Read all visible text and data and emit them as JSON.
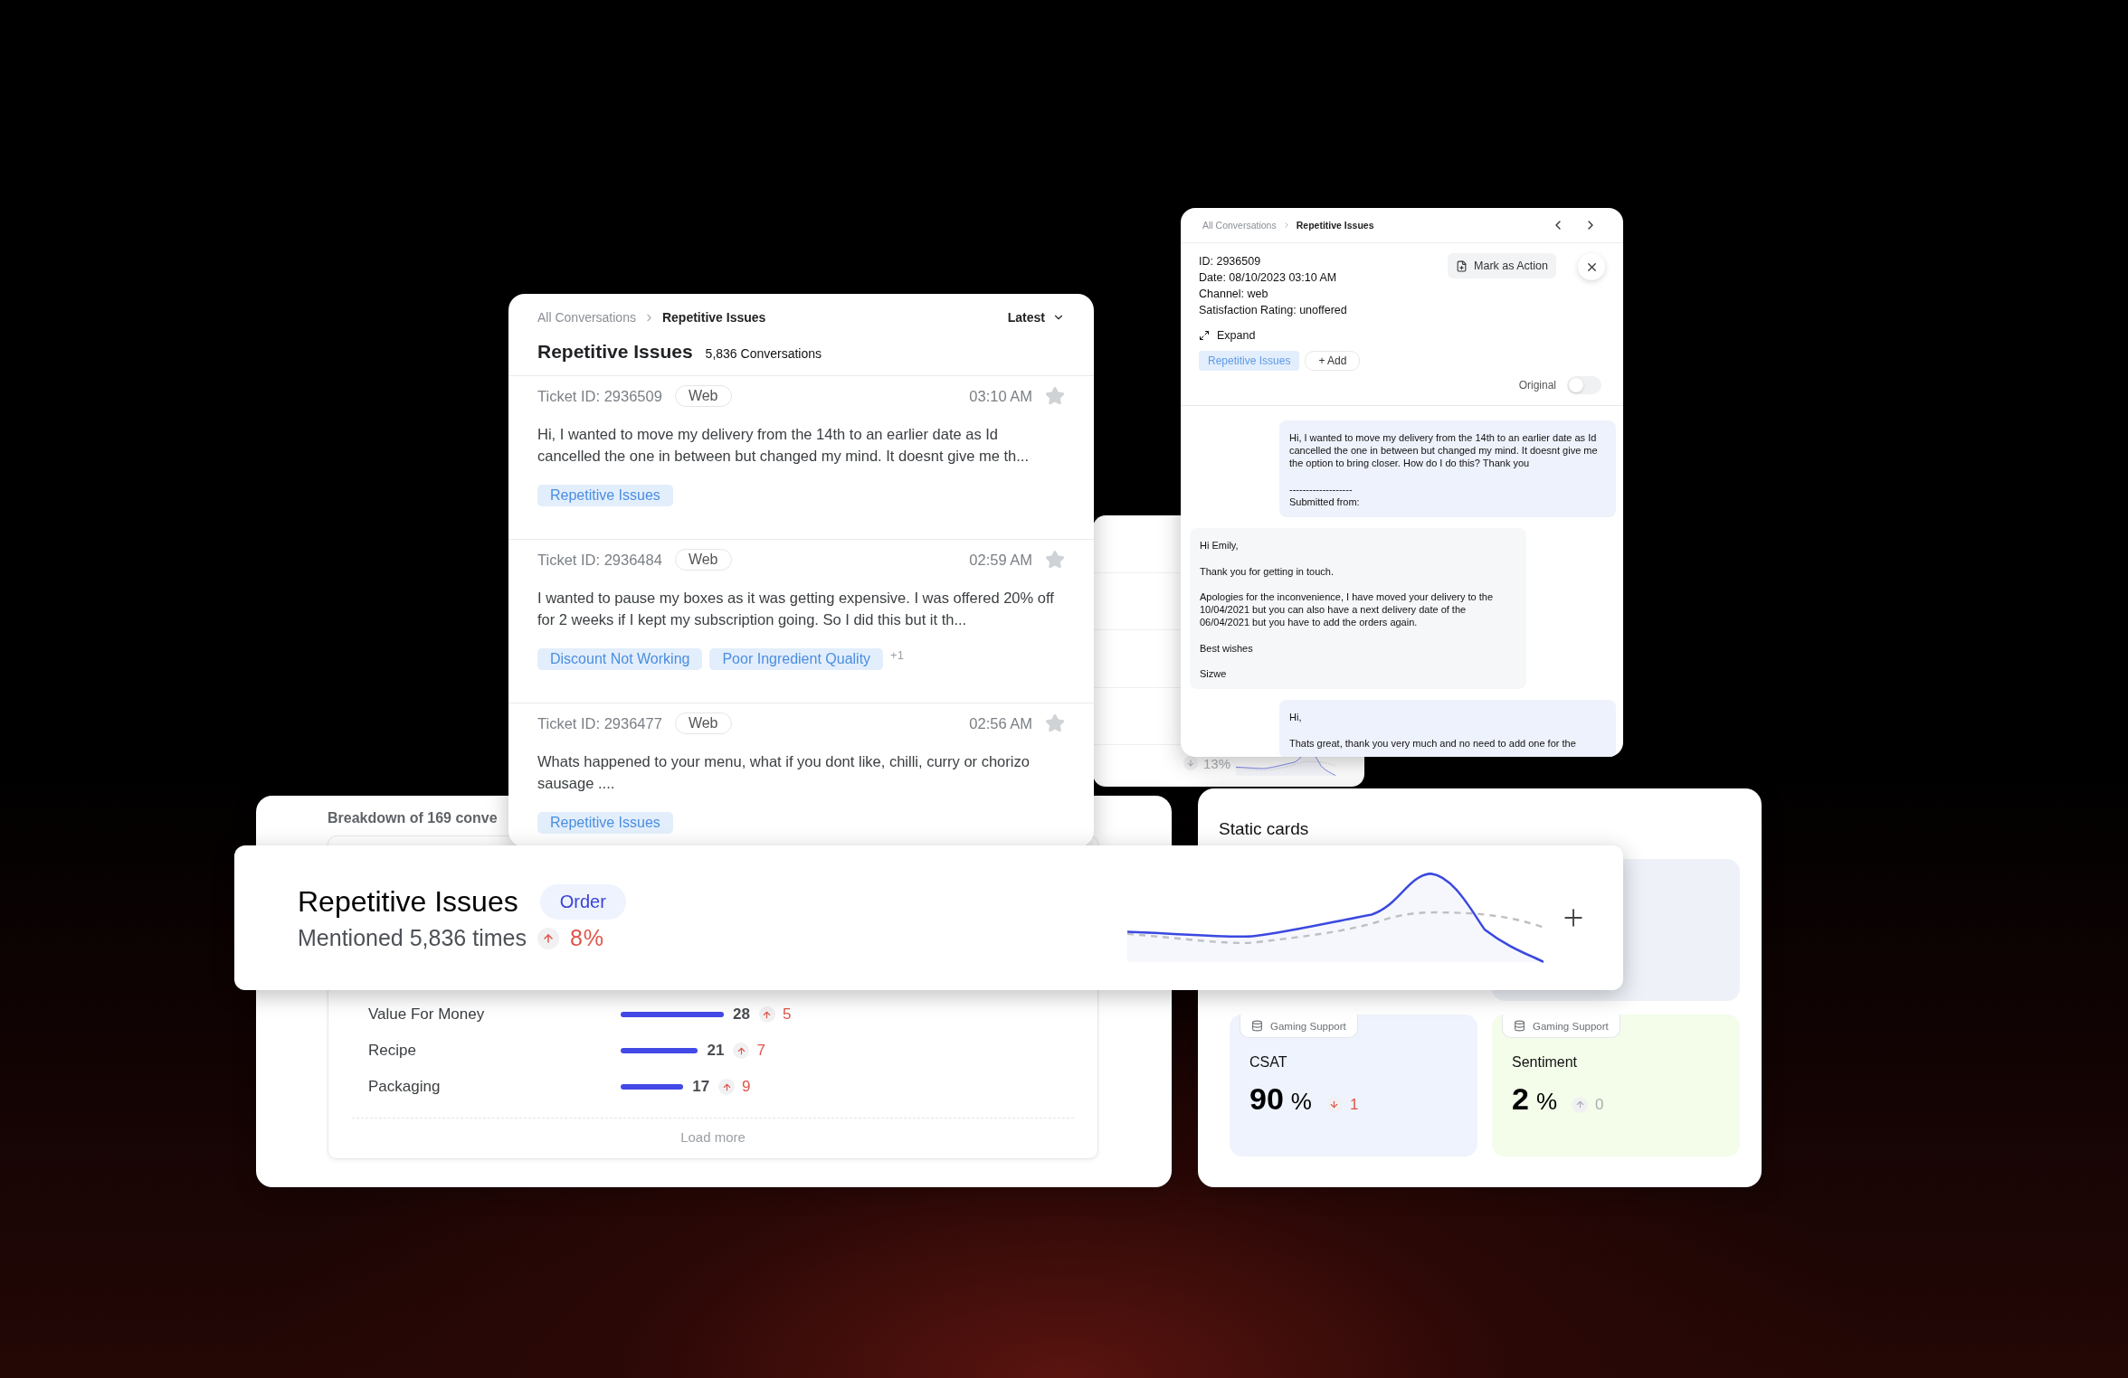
{
  "background_panel": {
    "change": "13%",
    "up": false,
    "muted": true
  },
  "breakdown_panel": {
    "title": "Breakdown of 169 conve",
    "rows": [
      {
        "label": "Value For Money",
        "count": "28",
        "change": "5",
        "up": true,
        "muted": false
      },
      {
        "label": "Recipe",
        "count": "21",
        "change": "7",
        "up": true,
        "muted": false
      },
      {
        "label": "Packaging",
        "count": "17",
        "change": "9",
        "up": true,
        "muted": false
      }
    ],
    "load_more": "Load more"
  },
  "static_cards": {
    "title": "Static cards",
    "cards": [
      {
        "source": "Gaming Support",
        "label": "CSAT",
        "value": "90",
        "unit": "%",
        "change": "1",
        "up": false,
        "muted": false,
        "color": "#eef3fd"
      },
      {
        "source": "Gaming Support",
        "label": "Sentiment",
        "value": "2",
        "unit": "%",
        "change": "0",
        "up": true,
        "muted": true,
        "color": "#f3fdea"
      }
    ]
  },
  "list_panel": {
    "breadcrumb": [
      "All Conversations",
      "Repetitive Issues"
    ],
    "sort": "Latest",
    "title": "Repetitive Issues",
    "count": "5,836 Conversations",
    "tickets": [
      {
        "id": "Ticket ID: 2936509",
        "channel": "Web",
        "time": "03:10 AM",
        "starred": false,
        "text": "Hi, I wanted to move my delivery from the 14th to an earlier date as Id cancelled the one in between but changed my mind. It doesnt give me th...",
        "tags": [
          "Repetitive Issues"
        ]
      },
      {
        "id": "Ticket ID: 2936484",
        "channel": "Web",
        "time": "02:59 AM",
        "starred": false,
        "text": "I wanted to pause my boxes as it was getting expensive. I was offered 20% off for 2 weeks if I kept my subscription going. So I did this but it th...",
        "tags": [
          "Discount Not Working",
          "Poor Ingredient Quality"
        ],
        "more": "+1"
      },
      {
        "id": "Ticket ID: 2936477",
        "channel": "Web",
        "time": "02:56 AM",
        "starred": false,
        "text": "Whats happened to your menu,  what if you dont like, chilli, curry or chorizo  sausage ....",
        "tags": [
          "Repetitive Issues"
        ]
      }
    ]
  },
  "detail_panel": {
    "breadcrumb": [
      "All Conversations",
      "Repetitive Issues"
    ],
    "meta": [
      "ID: 2936509",
      "Date: 08/10/2023 03:10 AM",
      "Channel: web",
      "Satisfaction Rating: unoffered"
    ],
    "action": "Mark as Action",
    "expand": "Expand",
    "tags": [
      "Repetitive Issues"
    ],
    "add": "+ Add",
    "toggle": {
      "label": "Original",
      "on": false
    },
    "messages": [
      {
        "kind": "customer",
        "text": "Hi, I wanted to move my delivery from the 14th to an earlier date as Id cancelled the one in between but changed my mind. It doesnt give me the option to bring closer. How do I do this? Thank you\n\n-------------------\nSubmitted from:"
      },
      {
        "kind": "agent",
        "text": "Hi Emily,\n\nThank you for getting in touch.\n\nApologies for the inconvenience, I have moved your delivery to the 10/04/2021 but you can also have a next delivery date of the 06/04/2021 but you have to add the orders again.\n\nBest wishes\n\nSizwe"
      },
      {
        "kind": "customer",
        "text": "Hi,\n\nThats great, thank you very much and no need to add one for the"
      }
    ]
  },
  "highlight_bar": {
    "title": "Repetitive Issues",
    "tag": "Order",
    "subtitle": "Mentioned 5,836 times",
    "change": "8%",
    "up": true,
    "muted": false
  }
}
